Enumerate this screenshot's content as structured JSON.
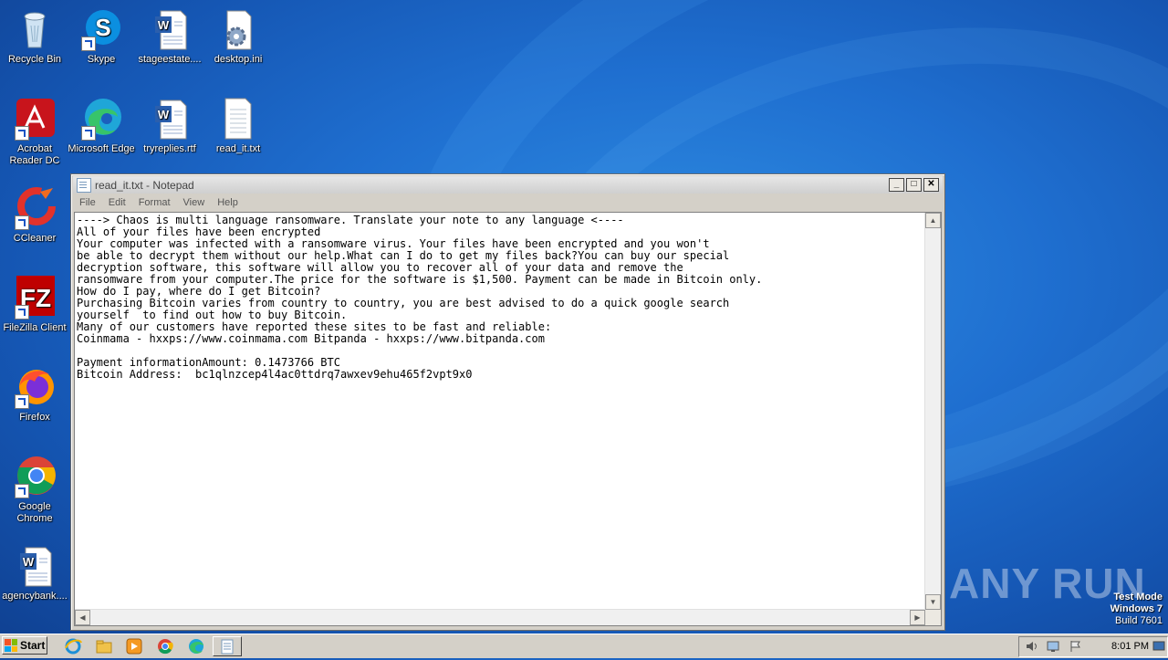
{
  "desktop": {
    "icons": [
      {
        "label": "Recycle Bin",
        "icon": "recycle-bin-icon"
      },
      {
        "label": "Skype",
        "icon": "skype-icon"
      },
      {
        "label": "stageestate....",
        "icon": "word-document-icon"
      },
      {
        "label": "desktop.ini",
        "icon": "settings-file-icon"
      },
      {
        "label": "Acrobat Reader DC",
        "icon": "acrobat-icon"
      },
      {
        "label": "Microsoft Edge",
        "icon": "edge-icon"
      },
      {
        "label": "tryreplies.rtf",
        "icon": "word-document-icon"
      },
      {
        "label": "read_it.txt",
        "icon": "text-file-icon"
      },
      {
        "label": "CCleaner",
        "icon": "ccleaner-icon"
      },
      {
        "label": "FileZilla Client",
        "icon": "filezilla-icon"
      },
      {
        "label": "Firefox",
        "icon": "firefox-icon"
      },
      {
        "label": "Google Chrome",
        "icon": "chrome-icon"
      },
      {
        "label": "agencybank....",
        "icon": "word-document-icon"
      }
    ]
  },
  "notepad": {
    "title": "read_it.txt - Notepad",
    "menu": [
      "File",
      "Edit",
      "Format",
      "View",
      "Help"
    ],
    "content": "----> Chaos is multi language ransomware. Translate your note to any language <----\nAll of your files have been encrypted\nYour computer was infected with a ransomware virus. Your files have been encrypted and you won't\nbe able to decrypt them without our help.What can I do to get my files back?You can buy our special\ndecryption software, this software will allow you to recover all of your data and remove the\nransomware from your computer.The price for the software is $1,500. Payment can be made in Bitcoin only.\nHow do I pay, where do I get Bitcoin?\nPurchasing Bitcoin varies from country to country, you are best advised to do a quick google search\nyourself  to find out how to buy Bitcoin.\nMany of our customers have reported these sites to be fast and reliable:\nCoinmama - hxxps://www.coinmama.com Bitpanda - hxxps://www.bitpanda.com\n\nPayment informationAmount: 0.1473766 BTC\nBitcoin Address:  bc1qlnzcep4l4ac0ttdrq7awxev9ehu465f2vpt9x0"
  },
  "watermark": {
    "brand": "ANY RUN",
    "line1": "Test Mode",
    "line2": "Windows 7",
    "line3": "Build 7601"
  },
  "taskbar": {
    "start_label": "Start",
    "clock": "8:01 PM"
  }
}
